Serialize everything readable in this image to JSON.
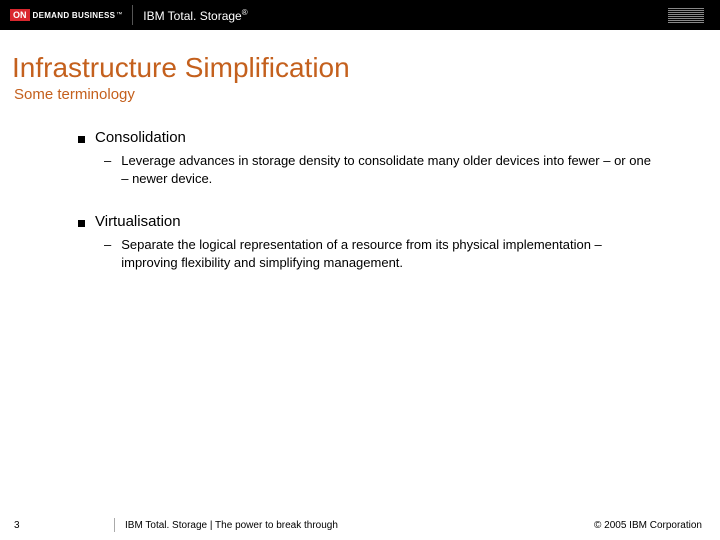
{
  "header": {
    "badge_on": "ON",
    "badge_text": "DEMAND BUSINESS",
    "badge_tm": "™",
    "product": "IBM Total. Storage",
    "product_reg": "®"
  },
  "title": "Infrastructure Simplification",
  "subtitle": "Some terminology",
  "terms": [
    {
      "heading": "Consolidation",
      "desc": "Leverage advances in storage density to consolidate many older devices into fewer – or one – newer device."
    },
    {
      "heading": "Virtualisation",
      "desc": "Separate the logical representation of a resource from its physical implementation – improving flexibility and simplifying management."
    }
  ],
  "footer": {
    "page": "3",
    "left": "IBM Total. Storage  |  The power to break through",
    "right": "© 2005 IBM Corporation"
  }
}
